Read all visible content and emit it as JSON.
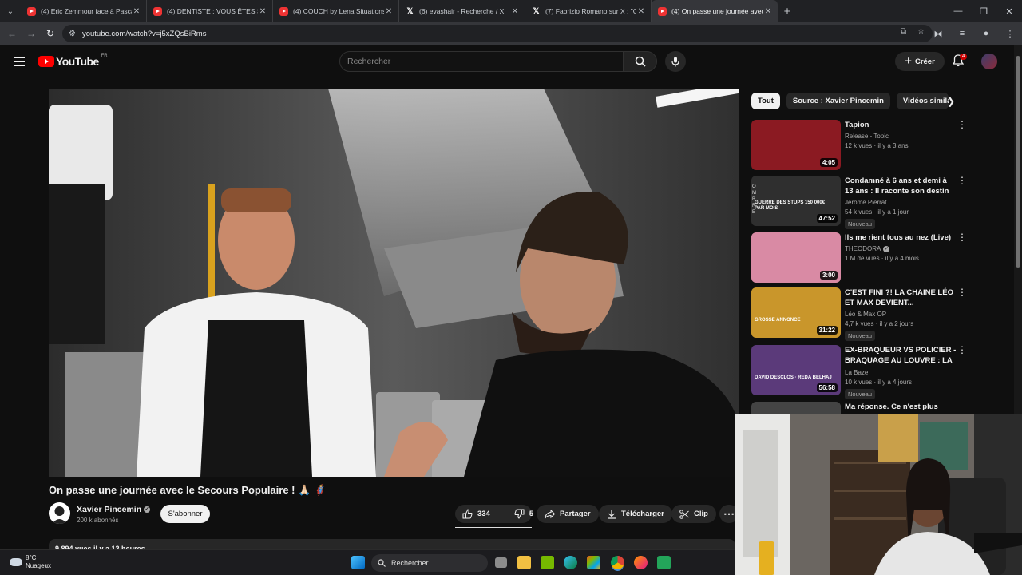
{
  "browser": {
    "tabs": [
      {
        "title": "(4) Eric Zemmour face à Pascal",
        "icon": "youtube-favicon"
      },
      {
        "title": "(4) DENTISTE : VOUS ÊTES SALE",
        "icon": "youtube-favicon"
      },
      {
        "title": "(4) COUCH by Lena Situations",
        "icon": "youtube-favicon"
      },
      {
        "title": "(6) evashair - Recherche / X",
        "icon": "x-favicon"
      },
      {
        "title": "(7) Fabrizio Romano sur X : \"Ca",
        "icon": "x-favicon"
      },
      {
        "title": "(4) On passe une journée avec",
        "icon": "youtube-favicon",
        "active": true
      }
    ],
    "url": "youtube.com/watch?v=j5xZQsBiRms"
  },
  "header": {
    "logo_text": "YouTube",
    "country_code": "FR",
    "search_placeholder": "Rechercher",
    "create_label": "Créer",
    "notification_count": "4"
  },
  "video": {
    "title": "On passe une journée avec le Secours Populaire ! 🙏🏻 🦸🏼",
    "channel_name": "Xavier Pincemin",
    "subscribers": "200 k abonnés",
    "subscribe_label": "S'abonner",
    "likes": "334",
    "dislikes": "5",
    "share_label": "Partager",
    "download_label": "Télécharger",
    "clip_label": "Clip",
    "views_date": "9 894 vues  il y a 12 heures"
  },
  "chips": [
    "Tout",
    "Source : Xavier Pincemin",
    "Vidéos similaires"
  ],
  "recommendations": [
    {
      "title": "Tapion",
      "channel": "Release - Topic",
      "meta": "12 k vues · il y a 3 ans",
      "duration": "4:05",
      "badge": "",
      "verified": false,
      "thumb_color": "#8b1a22"
    },
    {
      "title": "Condamné à 6 ans et demi à 13 ans : Il raconte son destin",
      "channel": "Jérôme Pierrat",
      "meta": "54 k vues · il y a 1 jour",
      "duration": "47:52",
      "badge": "Nouveau",
      "verified": false,
      "thumb_color": "#2f2f2f",
      "thumb_text": "GUERRE DES STUPS 150 000€ PAR MOIS",
      "thumb_side": "OMBRE"
    },
    {
      "title": "Ils me rient tous au nez (Live)",
      "channel": "THEODORA",
      "meta": "1 M de vues · il y a 4 mois",
      "duration": "3:00",
      "badge": "",
      "verified": true,
      "thumb_color": "#d98aa4"
    },
    {
      "title": "C'EST FINI ?! LA CHAINE LÉO ET MAX DEVIENT...",
      "channel": "Léo & Max OP",
      "meta": "4,7 k vues · il y a 2 jours",
      "duration": "31:22",
      "badge": "Nouveau",
      "verified": false,
      "thumb_color": "#c9962b",
      "thumb_text": "GROSSE ANNONCE"
    },
    {
      "title": "EX-BRAQUEUR VS POLICIER - BRAQUAGE AU LOUVRE : LA ...",
      "channel": "La Baze",
      "meta": "10 k vues · il y a 4 jours",
      "duration": "56:58",
      "badge": "Nouveau",
      "verified": false,
      "thumb_color": "#5b3a7a",
      "thumb_text": "DAVID DESCLOS · REDA BELHAJ"
    },
    {
      "title": "Ma réponse. Ce n'est plus",
      "channel": "",
      "meta": "",
      "duration": "",
      "badge": "",
      "verified": false,
      "thumb_color": "#444"
    }
  ],
  "taskbar": {
    "temperature": "8°C",
    "weather": "Nuageux",
    "search_label": "Rechercher"
  }
}
